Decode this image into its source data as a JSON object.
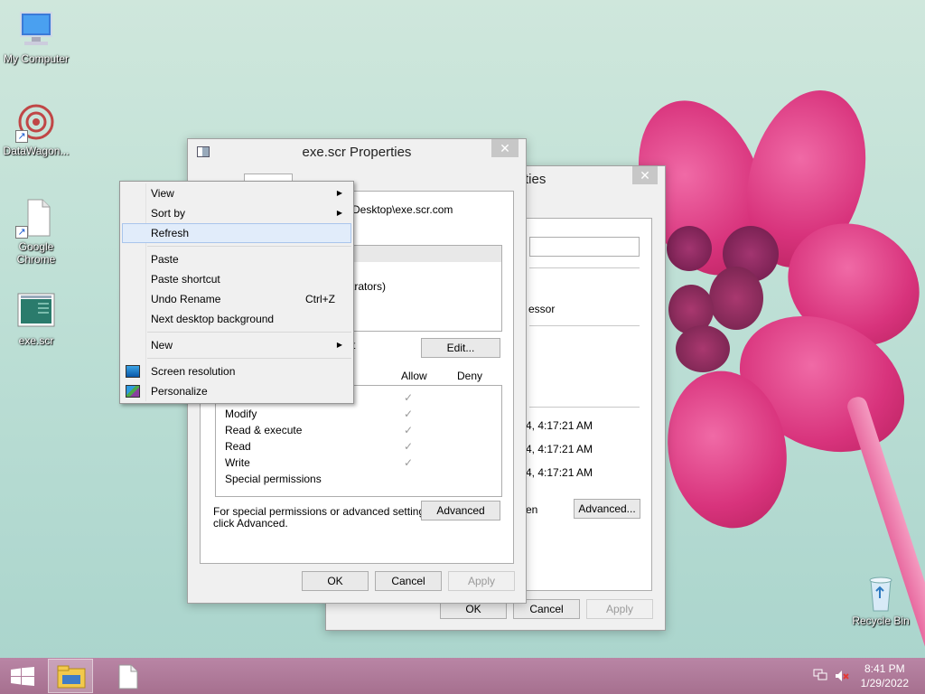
{
  "desktop": {
    "icons": [
      {
        "label": "My Computer",
        "icon": "computer-icon"
      },
      {
        "label": "DataWagon...",
        "icon": "datawagon-icon"
      },
      {
        "label": "Google Chrome",
        "icon": "document-icon"
      },
      {
        "label": "exe.scr",
        "icon": "screensaver-icon"
      },
      {
        "label": "Recycle Bin",
        "icon": "recycle-bin-icon"
      }
    ]
  },
  "back_window": {
    "title": "exe.scr Properties",
    "title_visible": "rties",
    "rows": {
      "partial_suffix": "essor",
      "date1": "4, 4:17:21 AM",
      "date2": "4, 4:17:21 AM",
      "date3": "4, 4:17:21 AM",
      "partial_en": "en"
    },
    "buttons": {
      "advanced": "Advanced...",
      "ok": "OK",
      "cancel": "Cancel",
      "apply": "Apply"
    }
  },
  "front_window": {
    "title": "exe.scr Properties",
    "object_path": "Desktop\\exe.scr.com",
    "partial_user": "trators)",
    "partial_colon": "t",
    "edit_button": "Edit...",
    "perm_headers": {
      "allow": "Allow",
      "deny": "Deny"
    },
    "permissions": [
      {
        "name": "Modify",
        "allow": "✓"
      },
      {
        "name": "Read & execute",
        "allow": "✓"
      },
      {
        "name": "Read",
        "allow": "✓"
      },
      {
        "name": "Write",
        "allow": "✓"
      },
      {
        "name": "Special permissions",
        "allow": ""
      }
    ],
    "first_check": "✓",
    "special_text_1": "For special permissions or advanced settings,",
    "special_text_2": "click Advanced.",
    "advanced_button": "Advanced",
    "buttons": {
      "ok": "OK",
      "cancel": "Cancel",
      "apply": "Apply"
    }
  },
  "context_menu": {
    "items": {
      "view": "View",
      "sort_by": "Sort by",
      "refresh": "Refresh",
      "paste": "Paste",
      "paste_shortcut": "Paste shortcut",
      "undo_rename": "Undo Rename",
      "undo_shortcut": "Ctrl+Z",
      "next_bg": "Next desktop background",
      "new": "New",
      "screen_resolution": "Screen resolution",
      "personalize": "Personalize"
    },
    "submenu_arrow": "▶"
  },
  "taskbar": {
    "time": "8:41 PM",
    "date": "1/29/2022"
  },
  "colors": {
    "accent": "#3399ff",
    "menu_highlight": "#e1ecfa",
    "taskbar": "#a87896"
  }
}
